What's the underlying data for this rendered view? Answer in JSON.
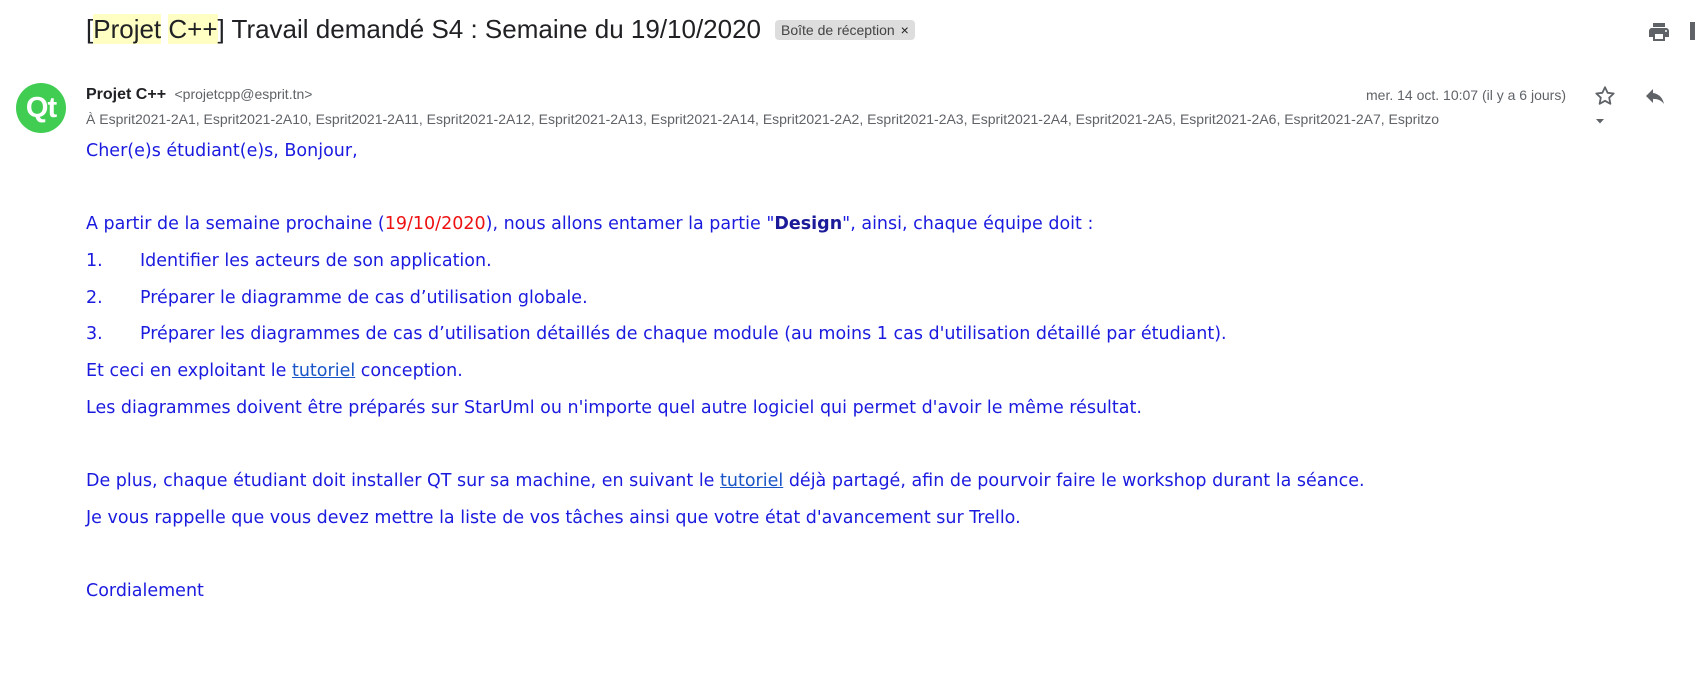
{
  "subject": {
    "bracket_open": "[",
    "hl1": "Projet",
    "space": " ",
    "hl2": "C++",
    "rest": "] Travail demandé S4 : Semaine du 19/10/2020"
  },
  "label": {
    "text": "Boîte de réception",
    "close": "×"
  },
  "avatar": {
    "text": "Qt",
    "color": "#41cd52"
  },
  "sender": {
    "name": "Projet C++",
    "email": "<projetcpp@esprit.tn>"
  },
  "date": "mer. 14 oct. 10:07 (il y a 6 jours)",
  "to_line": "À Esprit2021-2A1, Esprit2021-2A10, Esprit2021-2A11, Esprit2021-2A12, Esprit2021-2A13, Esprit2021-2A14, Esprit2021-2A2, Esprit2021-2A3, Esprit2021-2A4, Esprit2021-2A5, Esprit2021-2A6, Esprit2021-2A7, Espritzo",
  "icons": [
    "print-icon",
    "star-icon",
    "reply-icon",
    "chevron-down-icon"
  ],
  "body": {
    "greeting": "Cher(e)s étudiant(e)s, Bonjour,",
    "intro_a": "A partir de la semaine prochaine (",
    "intro_date": "19/10/2020",
    "intro_b": "), nous allons entamer la partie \"",
    "intro_design": "Design",
    "intro_c": "\", ainsi, chaque équipe doit :",
    "items": [
      {
        "num": "1.",
        "text": "Identifier les acteurs de son application."
      },
      {
        "num": "2.",
        "text": "Préparer le diagramme de cas d’utilisation globale."
      },
      {
        "num": "3.",
        "text": "Préparer les diagrammes de cas d’utilisation détaillés de chaque module (au moins 1 cas d'utilisation détaillé par étudiant)."
      }
    ],
    "conception_a": "Et ceci en exploitant le ",
    "conception_link": "tutoriel",
    "conception_b": " conception.",
    "starum": "Les diagrammes doivent être préparés sur StarUml ou n'importe quel autre logiciel qui permet d'avoir le même résultat.",
    "qt_a": "De plus, chaque étudiant doit installer QT sur sa machine, en suivant le ",
    "qt_link": "tutoriel",
    "qt_b": " déjà partagé, afin de pourvoir faire le workshop durant la séance.",
    "trello": "Je vous rappelle que vous devez mettre la liste de vos tâches ainsi que votre état d'avancement sur Trello.",
    "closing": "Cordialement"
  }
}
